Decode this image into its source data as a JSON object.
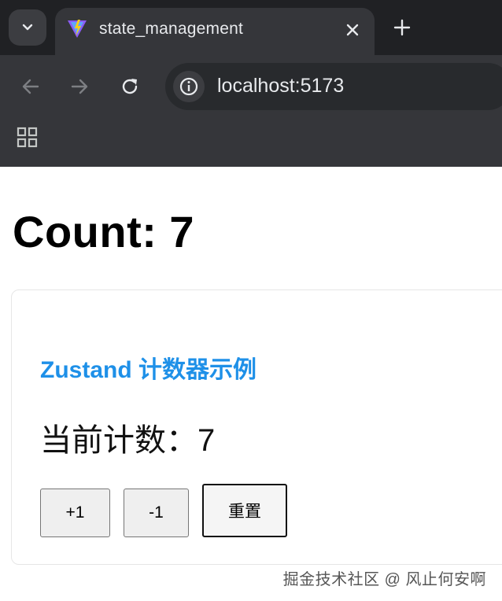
{
  "browser": {
    "tab": {
      "title": "state_management"
    },
    "address_bar": {
      "url": "localhost:5173"
    }
  },
  "page": {
    "heading": "Count: 7",
    "card": {
      "title": "Zustand 计数器示例",
      "count_text": "当前计数：7",
      "buttons": {
        "increment": "+1",
        "decrement": "-1",
        "reset": "重置"
      }
    }
  },
  "watermark": "掘金技术社区 @ 风止何安啊",
  "colors": {
    "title_blue": "#1e90e8",
    "chrome_dark": "#202124",
    "toolbar": "#35363a"
  }
}
